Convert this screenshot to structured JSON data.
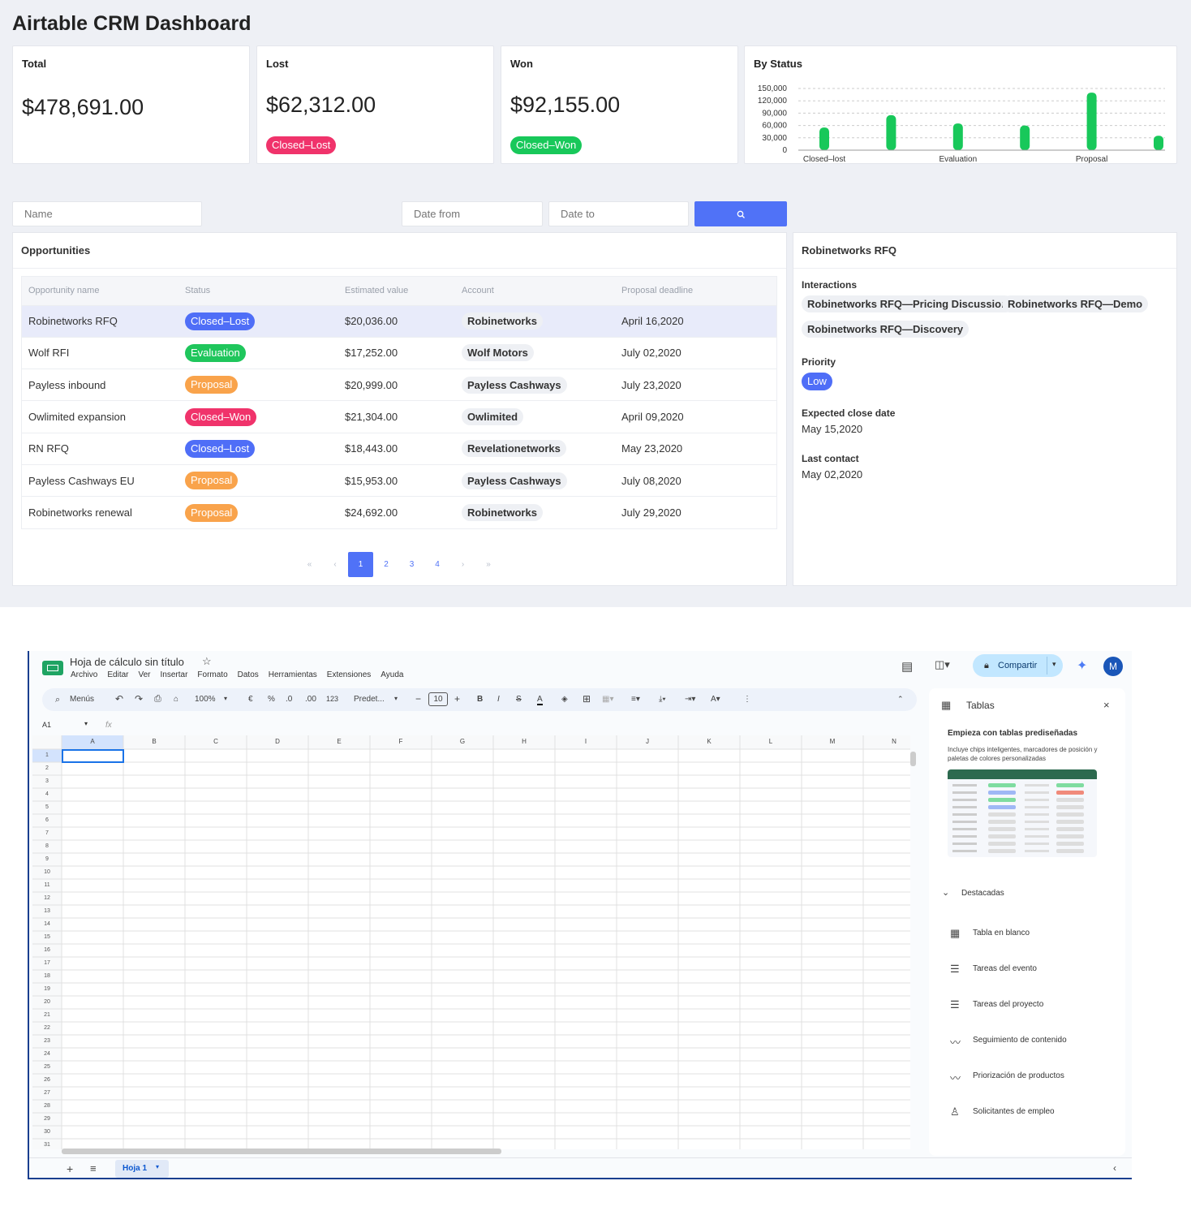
{
  "dashboard": {
    "title": "Airtable CRM Dashboard",
    "kpis": {
      "total": {
        "label": "Total",
        "value": "$478,691.00"
      },
      "lost": {
        "label": "Lost",
        "value": "$62,312.00",
        "badge": "Closed–Lost"
      },
      "won": {
        "label": "Won",
        "value": "$92,155.00",
        "badge": "Closed–Won"
      }
    },
    "by_status": {
      "label": "By Status"
    },
    "filters": {
      "name_placeholder": "Name",
      "date_from_placeholder": "Date from",
      "date_to_placeholder": "Date to"
    },
    "opportunities": {
      "title": "Opportunities",
      "columns": [
        "Opportunity name",
        "Status",
        "Estimated value",
        "Account",
        "Proposal deadline"
      ],
      "rows": [
        {
          "name": "Robinetworks RFQ",
          "status": "Closed–Lost",
          "status_key": "cl",
          "value": "$20,036.00",
          "account": "Robinetworks",
          "deadline": "April 16,2020"
        },
        {
          "name": "Wolf RFI",
          "status": "Evaluation",
          "status_key": "ev",
          "value": "$17,252.00",
          "account": "Wolf Motors",
          "deadline": "July 02,2020"
        },
        {
          "name": "Payless inbound",
          "status": "Proposal",
          "status_key": "pr",
          "value": "$20,999.00",
          "account": "Payless Cashways",
          "deadline": "July 23,2020"
        },
        {
          "name": "Owlimited expansion",
          "status": "Closed–Won",
          "status_key": "cw",
          "value": "$21,304.00",
          "account": "Owlimited",
          "deadline": "April 09,2020"
        },
        {
          "name": "RN RFQ",
          "status": "Closed–Lost",
          "status_key": "cl",
          "value": "$18,443.00",
          "account": "Revelationetworks",
          "deadline": "May 23,2020"
        },
        {
          "name": "Payless Cashways EU",
          "status": "Proposal",
          "status_key": "pr",
          "value": "$15,953.00",
          "account": "Payless Cashways",
          "deadline": "July 08,2020"
        },
        {
          "name": "Robinetworks renewal",
          "status": "Proposal",
          "status_key": "pr",
          "value": "$24,692.00",
          "account": "Robinetworks",
          "deadline": "July 29,2020"
        }
      ]
    },
    "pagination": {
      "first": "«",
      "prev": "‹",
      "pages": [
        "1",
        "2",
        "3",
        "4"
      ],
      "next": "›",
      "last": "»"
    },
    "detail": {
      "title": "Robinetworks RFQ",
      "interactions_label": "Interactions",
      "interactions": [
        "Robinetworks RFQ—Pricing Discussion",
        "Robinetworks RFQ—Demo",
        "Robinetworks RFQ—Discovery"
      ],
      "priority_label": "Priority",
      "priority": "Low",
      "close_label": "Expected close date",
      "close": "May 15,2020",
      "contact_label": "Last contact",
      "contact": "May 02,2020"
    }
  },
  "chart_data": {
    "type": "bar",
    "title": "By Status",
    "yticks": [
      "150,000",
      "120,000",
      "90,000",
      "60,000",
      "30,000",
      "0"
    ],
    "ylim": [
      0,
      150000
    ],
    "categories": [
      "Closed–lost",
      "",
      "Evaluation",
      "",
      "Proposal",
      ""
    ],
    "values": [
      55000,
      85000,
      65000,
      60000,
      140000,
      35000
    ],
    "color": "#18c85a"
  },
  "sheets": {
    "title": "Hoja de cálculo sin título",
    "menu": [
      "Archivo",
      "Editar",
      "Ver",
      "Insertar",
      "Formato",
      "Datos",
      "Herramientas",
      "Extensiones",
      "Ayuda"
    ],
    "share": "Compartir",
    "avatar": "M",
    "search": "Menús",
    "zoom": "100%",
    "font": "Predet...",
    "font_size": "10",
    "cell_ref": "A1",
    "fx": "fx",
    "toolbar": {
      "euro": "€",
      "pct": "%",
      "dec_less": ".0",
      "dec_more": ".00",
      "fmt123": "123",
      "bold": "B",
      "italic": "I",
      "strike": "S",
      "textcolor": "A"
    },
    "columns": [
      "A",
      "B",
      "C",
      "D",
      "E",
      "F",
      "G",
      "H",
      "I",
      "J",
      "K",
      "L",
      "M",
      "N"
    ],
    "tab": "Hoja 1",
    "panel": {
      "title": "Tablas",
      "heading": "Empieza con tablas prediseñadas",
      "desc": "Incluye chips inteligentes, marcadores de posición y paletas de colores personalizadas",
      "section": "Destacadas",
      "items": [
        "Tabla en blanco",
        "Tareas del evento",
        "Tareas del proyecto",
        "Seguimiento de contenido",
        "Priorización de productos",
        "Solicitantes de empleo"
      ]
    }
  }
}
